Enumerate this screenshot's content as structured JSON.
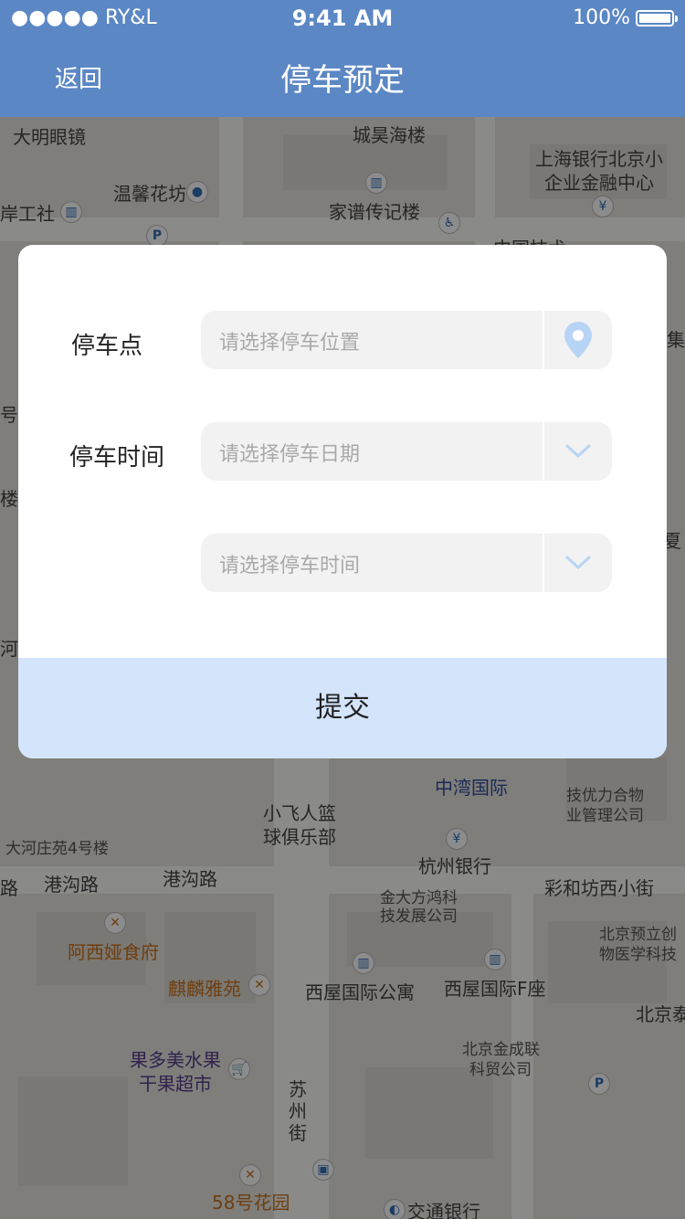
{
  "status_bar": {
    "carrier": "●●●●● RY&L",
    "time": "9:41 AM",
    "battery": "100%"
  },
  "nav": {
    "back_label": "返回",
    "title": "停车预定"
  },
  "map": {
    "labels": [
      "大明眼镜",
      "城昊海楼",
      "上海银行北京小",
      "企业金融中心",
      "温馨花坊",
      "岸工社",
      "家谱传记楼",
      "中国技术",
      "中湾国际",
      "技优力合物",
      "业管理公司",
      "小飞人篮",
      "球俱乐部",
      "大河庄苑4号楼",
      "港沟路",
      "港沟路",
      "杭州银行",
      "金大方鸿科",
      "技发展公司",
      "彩和坊西小街",
      "路",
      "北京预立创",
      "物医学科技",
      "阿西娅食府",
      "麒麟雅苑",
      "西屋国际公寓",
      "西屋国际F座",
      "北京泰",
      "北京金成联",
      "科贸公司",
      "果多美水果",
      "干果超市",
      "苏",
      "州",
      "街",
      "58号花园",
      "交通银行",
      "集",
      "号",
      "楼",
      "夏",
      "河"
    ]
  },
  "form": {
    "parking_spot": {
      "label": "停车点",
      "placeholder": "请选择停车位置",
      "icon": "location-pin-icon"
    },
    "parking_time": {
      "label": "停车时间",
      "date_placeholder": "请选择停车日期",
      "time_placeholder": "请选择停车时间",
      "icon": "chevron-down-icon"
    },
    "submit_label": "提交"
  },
  "colors": {
    "primary": "#5b87c4",
    "submit_bg": "#d3e4fb",
    "field_bg": "#f2f2f2",
    "icon_accent": "#b8d4f5"
  }
}
